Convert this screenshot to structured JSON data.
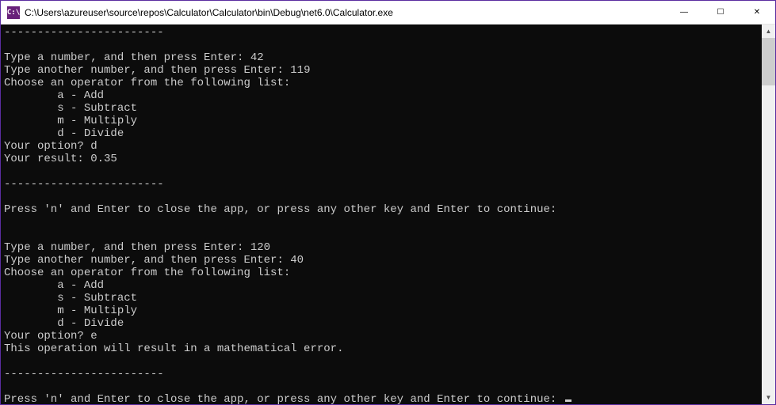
{
  "window": {
    "icon_text": "C:\\",
    "title": "C:\\Users\\azureuser\\source\\repos\\Calculator\\Calculator\\bin\\Debug\\net6.0\\Calculator.exe"
  },
  "console": {
    "separator": "------------------------",
    "prompt_num1": "Type a number, and then press Enter: ",
    "prompt_num2": "Type another number, and then press Enter: ",
    "choose_op": "Choose an operator from the following list:",
    "op_a": "        a - Add",
    "op_s": "        s - Subtract",
    "op_m": "        m - Multiply",
    "op_d": "        d - Divide",
    "your_option": "Your option? ",
    "your_result": "Your result: ",
    "error_msg": "This operation will result in a mathematical error.",
    "continue_prompt": "Press 'n' and Enter to close the app, or press any other key and Enter to continue: ",
    "run1": {
      "num1": "42",
      "num2": "119",
      "option": "d",
      "result": "0.35"
    },
    "run2": {
      "num1": "120",
      "num2": "40",
      "option": "e"
    }
  }
}
